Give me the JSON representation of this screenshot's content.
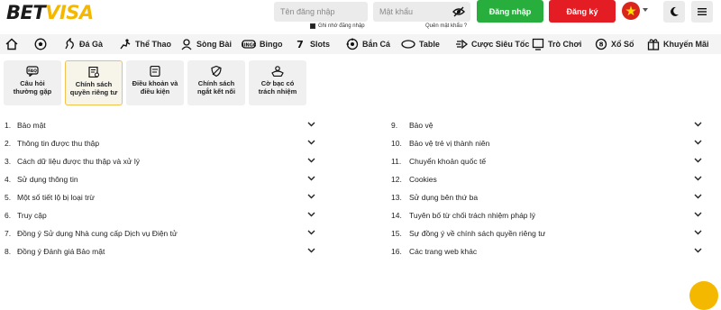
{
  "header": {
    "logo_left": "BET",
    "logo_right": "VISA",
    "username_placeholder": "Tên đăng nhập",
    "password_placeholder": "Mật khẩu",
    "remember_label": "Ghi nhớ đăng nhập",
    "forgot_label": "Quên mật khẩu ?",
    "login_label": "Đăng nhập",
    "register_label": "Đăng ký"
  },
  "nav": [
    {
      "icon": "home-icon",
      "label": ""
    },
    {
      "icon": "soccer-ball-icon",
      "label": ""
    },
    {
      "icon": "rooster-icon",
      "label": "Đá Gà"
    },
    {
      "icon": "sports-icon",
      "label": "Thể Thao"
    },
    {
      "icon": "dealer-icon",
      "label": "Sòng Bài"
    },
    {
      "icon": "bingo-icon",
      "label": "Bingo"
    },
    {
      "icon": "slot-icon",
      "label": "Slots"
    },
    {
      "icon": "fish-icon",
      "label": "Bắn Cá"
    },
    {
      "icon": "table-icon",
      "label": "Table"
    },
    {
      "icon": "speed-icon",
      "label": "Cược Siêu Tốc"
    },
    {
      "icon": "games-icon",
      "label": "Trò Chơi"
    },
    {
      "icon": "lottery-icon",
      "label": "Xổ Số"
    },
    {
      "icon": "gift-icon",
      "label": "Khuyến Mãi"
    }
  ],
  "cards": [
    {
      "line1": "Câu hỏi",
      "line2": "thường gặp",
      "icon": "faq-icon"
    },
    {
      "line1": "Chính sách",
      "line2": "quyền riêng tư",
      "icon": "privacy-doc-icon"
    },
    {
      "line1": "Điều khoản và",
      "line2": "điều kiện",
      "icon": "terms-icon"
    },
    {
      "line1": "Chính sách",
      "line2": "ngắt kết nối",
      "icon": "shield-off-icon"
    },
    {
      "line1": "Cờ bạc có",
      "line2": "trách nhiệm",
      "icon": "responsible-icon"
    }
  ],
  "sections_left": [
    {
      "num": "1.",
      "label": "Bảo mật"
    },
    {
      "num": "2.",
      "label": "Thông tin được thu thập"
    },
    {
      "num": "3.",
      "label": "Cách dữ liệu được thu thập và xử lý"
    },
    {
      "num": "4.",
      "label": "Sử dụng thông tin"
    },
    {
      "num": "5.",
      "label": "Một số tiết lộ bị loại trừ"
    },
    {
      "num": "6.",
      "label": "Truy cập"
    },
    {
      "num": "7.",
      "label": "Đồng ý Sử dụng Nhà cung cấp Dịch vụ Điện tử"
    },
    {
      "num": "8.",
      "label": "Đồng ý Đánh giá Bảo mật"
    }
  ],
  "sections_right": [
    {
      "num": "9.",
      "label": "Bảo vệ"
    },
    {
      "num": "10.",
      "label": "Bảo vệ trẻ vị thành niên"
    },
    {
      "num": "11.",
      "label": "Chuyển khoản quốc tế"
    },
    {
      "num": "12.",
      "label": "Cookies"
    },
    {
      "num": "13.",
      "label": "Sử dụng bên thứ ba"
    },
    {
      "num": "14.",
      "label": "Tuyên bố từ chối trách nhiệm pháp lý"
    },
    {
      "num": "15.",
      "label": "Sự đồng ý về chính sách quyền riêng tư"
    },
    {
      "num": "16.",
      "label": "Các trang web khác"
    }
  ],
  "colors": {
    "accent": "#f5b800",
    "login": "#27ae3c",
    "register": "#e31d23"
  }
}
